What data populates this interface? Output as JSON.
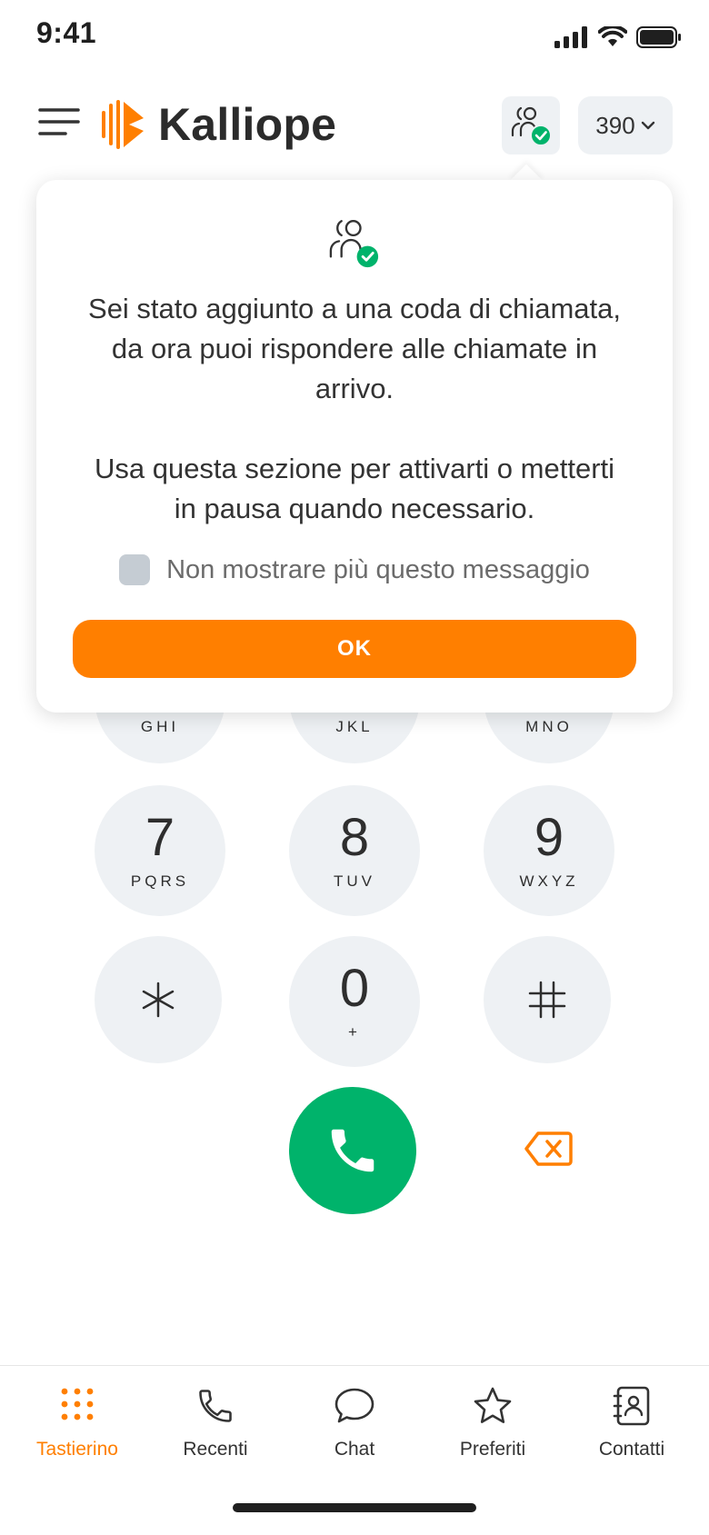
{
  "status_bar": {
    "time": "9:41"
  },
  "header": {
    "brand": "Kalliope",
    "extension": "390"
  },
  "popover": {
    "message_1": "Sei stato aggiunto a una coda di chiamata, da ora puoi rispondere alle chiamate in arrivo.",
    "message_2": "Usa questa sezione per attivarti o metterti in pausa quando necessario.",
    "dont_show_label": "Non mostrare più questo messaggio",
    "dont_show_checked": false,
    "ok_label": "OK"
  },
  "keypad": {
    "row3": [
      {
        "letters": "GHI"
      },
      {
        "letters": "JKL"
      },
      {
        "letters": "MNO"
      }
    ],
    "row4": [
      {
        "digit": "7",
        "letters": "PQRS"
      },
      {
        "digit": "8",
        "letters": "TUV"
      },
      {
        "digit": "9",
        "letters": "WXYZ"
      }
    ],
    "row5": [
      {
        "digit": "0",
        "letters": "+"
      }
    ]
  },
  "bottom_nav": [
    {
      "label": "Tastierino",
      "icon": "dialpad-icon",
      "active": true
    },
    {
      "label": "Recenti",
      "icon": "phone-icon",
      "active": false
    },
    {
      "label": "Chat",
      "icon": "chat-bubble-icon",
      "active": false
    },
    {
      "label": "Preferiti",
      "icon": "star-icon",
      "active": false
    },
    {
      "label": "Contatti",
      "icon": "contacts-book-icon",
      "active": false
    }
  ],
  "colors": {
    "accent": "#ff7f00",
    "call": "#00b36b",
    "key_bg": "#eef1f4"
  }
}
